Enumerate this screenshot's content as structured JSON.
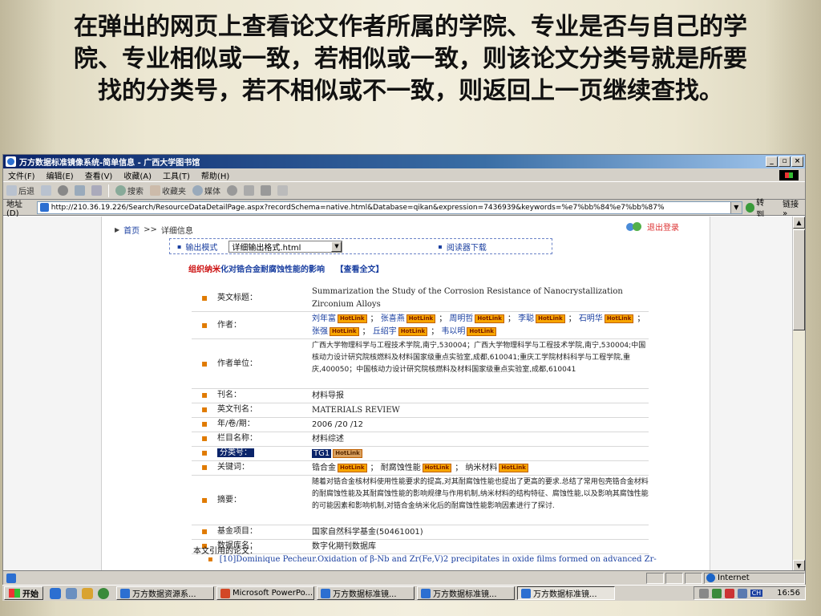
{
  "slide": {
    "title": "在弹出的网页上查看论文作者所属的学院、专业是否与自己的学院、专业相似或一致，若相似或一致，则该论文分类号就是所要找的分类号，若不相似或不一致，则返回上一页继续查找。"
  },
  "browser": {
    "window_title": "万方数据标准镜像系统-简单信息 - 广西大学图书馆",
    "win_buttons": {
      "minimize": "_",
      "restore": "▫",
      "close": "×"
    },
    "menu": [
      "文件(F)",
      "编辑(E)",
      "查看(V)",
      "收藏(A)",
      "工具(T)",
      "帮助(H)"
    ],
    "toolbar": {
      "back": "后退",
      "search": "搜索",
      "favorites": "收藏夹",
      "media": "媒体"
    },
    "address_label": "地址(D)",
    "address_value": "http://210.36.19.226/Search/ResourceDataDetailPage.aspx?recordSchema=native.html&Database=qikan&expression=7436939&keywords=%e7%bb%84%e7%bb%87%",
    "go_label": "转到",
    "links_label": "链接 »",
    "status_zone": "Internet"
  },
  "page": {
    "breadcrumb_home": "首页",
    "breadcrumb_sep": ">>",
    "breadcrumb_current": "详细信息",
    "logout": "退出登录",
    "export_label": "输出模式",
    "export_value": "详细输出格式.html",
    "reader_download": "阅读器下载",
    "title_highlight": "组织纳米",
    "title_rest": "化对锆合金耐腐蚀性能的影响",
    "view_fulltext": "【查看全文】",
    "hotlink_text": "HotLink",
    "fields": {
      "en_title_label": "英文标题：",
      "en_title_value": "Summarization the Study of the Corrosion Resistance of Nanocrystallization Zirconium Alloys",
      "authors_label": "作者：",
      "authors": [
        "刘年富",
        "张喜燕",
        "周明哲",
        "李聪",
        "石明华",
        "张强",
        "丘绍宇",
        "韦以明"
      ],
      "affil_label": "作者单位：",
      "affil_value": "广西大学物理科学与工程技术学院,南宁,530004；广西大学物理科学与工程技术学院,南宁,530004;中国核动力设计研究院核燃料及材料国家级重点实验室,成都,610041;重庆工学院材料科学与工程学院,重庆,400050；中国核动力设计研究院核燃料及材料国家级重点实验室,成都,610041",
      "journal_label": "刊名：",
      "journal_value": "材料导报",
      "en_journal_label": "英文刊名：",
      "en_journal_value": "MATERIALS REVIEW",
      "year_label": "年/卷/期：",
      "year_value": "2006 /20 /12",
      "column_label": "栏目名称：",
      "column_value": "材料综述",
      "class_label": "分类号：",
      "class_value": "TG1",
      "keywords_label": "关键词：",
      "keywords": [
        "锆合金",
        "耐腐蚀性能",
        "纳米材料"
      ],
      "abstract_label": "摘要：",
      "abstract_value": "随着对锆合金核材料使用性能要求的提高,对其耐腐蚀性能也提出了更高的要求.总结了常用包壳锆合金材料的耐腐蚀性能及其耐腐蚀性能的影响规律与作用机制,纳米材料的结构特征、腐蚀性能,以及影响其腐蚀性能的可能因素和影响机制,对锆合金纳米化后的耐腐蚀性能影响因素进行了探讨.",
      "fund_label": "基金项目：",
      "fund_value": "国家自然科学基金(50461001)",
      "db_label": "数据库名：",
      "db_value": "数字化期刊数据库"
    },
    "citations_heading": "本文引用的论文：",
    "citation_1": "[10]Dominique Pecheur.Oxidation of β-Nb and Zr(Fe,V)2 precipitates in oxide films formed on advanced Zr-"
  },
  "taskbar": {
    "start": "开始",
    "tasks": [
      "万方数据资源系...",
      "Microsoft PowerPo...",
      "万方数据标准镜...",
      "万方数据标准镜...",
      "万方数据标准镜..."
    ],
    "lang": "CH",
    "clock": "16:56"
  },
  "colors": {
    "link_blue": "#1a3fa0",
    "title_red": "#cc1111",
    "bullet_orange": "#e07a00",
    "hotlink_orange": "#f7a500",
    "selection_navy": "#0a246a"
  }
}
